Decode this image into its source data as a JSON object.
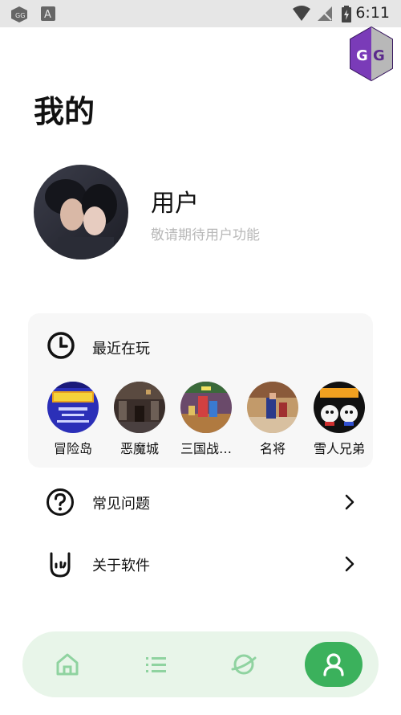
{
  "status_bar": {
    "time": "6:11"
  },
  "page": {
    "title": "我的"
  },
  "user": {
    "name": "用户",
    "subtitle": "敬请期待用户功能"
  },
  "recent": {
    "title": "最近在玩",
    "games": [
      {
        "label": "冒险岛"
      },
      {
        "label": "恶魔城"
      },
      {
        "label": "三国战…"
      },
      {
        "label": "名将"
      },
      {
        "label": "雪人兄弟"
      }
    ]
  },
  "menu": {
    "faq": "常见问题",
    "about": "关于软件"
  },
  "colors": {
    "accent": "#3bb15c",
    "nav_bg": "#e8f5e9",
    "nav_icon": "#8fd3a0"
  }
}
